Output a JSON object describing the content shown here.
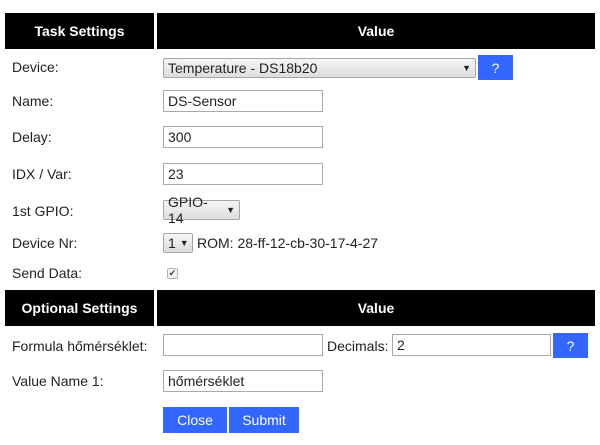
{
  "task_header": {
    "col1": "Task Settings",
    "col2": "Value"
  },
  "task": {
    "device": {
      "label": "Device:",
      "value": "Temperature - DS18b20",
      "help": "?"
    },
    "name": {
      "label": "Name:",
      "value": "DS-Sensor"
    },
    "delay": {
      "label": "Delay:",
      "value": "300"
    },
    "idx": {
      "label": "IDX / Var:",
      "value": "23"
    },
    "gpio": {
      "label": "1st GPIO:",
      "value": "GPIO-14"
    },
    "device_nr": {
      "label": "Device Nr:",
      "value": "1",
      "rom": "ROM: 28-ff-12-cb-30-17-4-27"
    },
    "send_data": {
      "label": "Send Data:",
      "checked": true,
      "check_glyph": "✔"
    }
  },
  "optional_header": {
    "col1": "Optional Settings",
    "col2": "Value"
  },
  "optional": {
    "formula": {
      "label": "Formula hőmérséklet:",
      "value": ""
    },
    "decimals": {
      "label": "Decimals:",
      "value": "2",
      "help": "?"
    },
    "value_name": {
      "label": "Value Name 1:",
      "value": "hőmérséklet"
    }
  },
  "buttons": {
    "close": "Close",
    "submit": "Submit"
  },
  "colors": {
    "header_bg": "#000000",
    "accent": "#3366ff"
  }
}
